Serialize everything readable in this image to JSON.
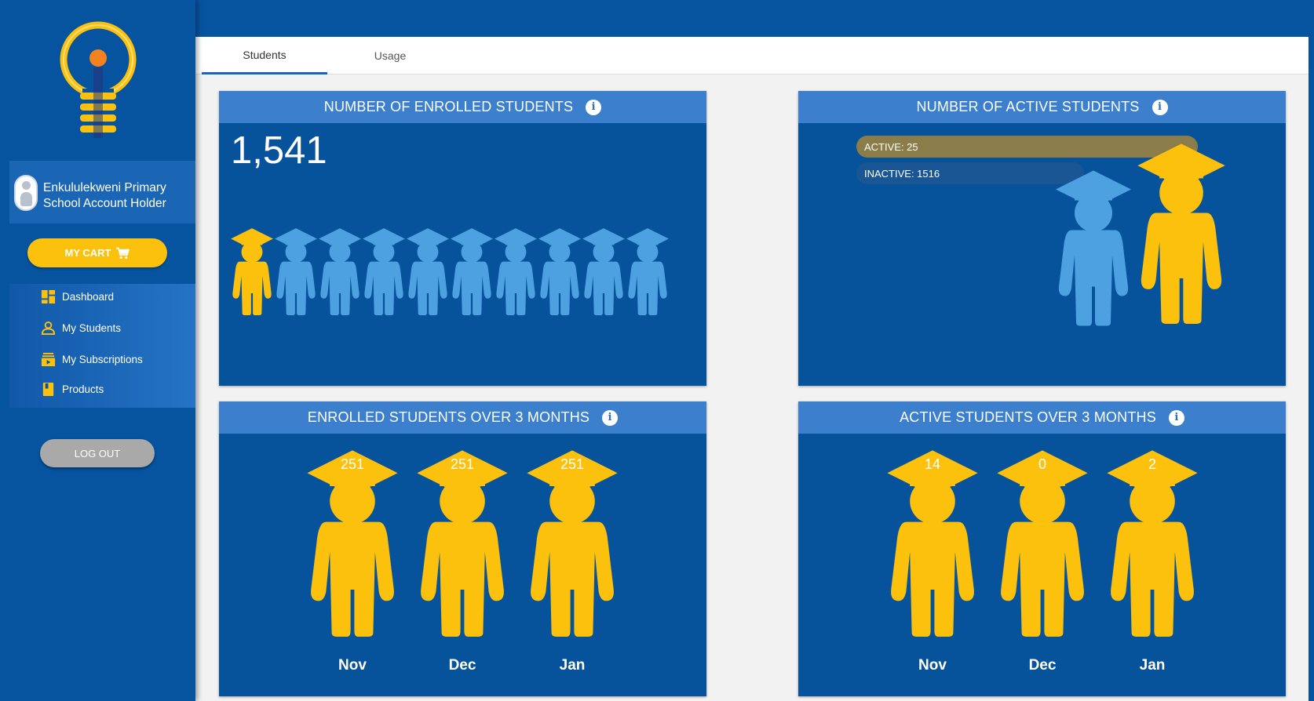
{
  "sidebar": {
    "account_name_line1": "Enkululekweni Primary",
    "account_name_line2": "School Account Holder",
    "cart_label": "MY CART",
    "nav": [
      {
        "label": "Dashboard",
        "icon": "dashboard-icon"
      },
      {
        "label": "My Students",
        "icon": "person-icon"
      },
      {
        "label": "My Subscriptions",
        "icon": "subscriptions-icon"
      },
      {
        "label": "Products",
        "icon": "book-icon"
      }
    ],
    "logout_label": "LOG OUT"
  },
  "tabs": [
    {
      "label": "Students",
      "active": true
    },
    {
      "label": "Usage",
      "active": false
    }
  ],
  "colors": {
    "brand_blue": "#0654a0",
    "header_blue": "#3b7fcd",
    "gold": "#fcc10c",
    "light_blue": "#4ea1e0"
  },
  "cards": {
    "enrolled": {
      "title": "NUMBER OF ENROLLED STUDENTS",
      "value": "1,541"
    },
    "active": {
      "title": "NUMBER OF ACTIVE STUDENTS",
      "active_label": "ACTIVE: 25",
      "inactive_label": "INACTIVE: 1516"
    },
    "enrolled_3m": {
      "title": "ENROLLED STUDENTS OVER 3 MONTHS",
      "values": [
        "251",
        "251",
        "251"
      ],
      "months": [
        "Nov",
        "Dec",
        "Jan"
      ]
    },
    "active_3m": {
      "title": "ACTIVE STUDENTS OVER 3 MONTHS",
      "values": [
        "14",
        "0",
        "2"
      ],
      "months": [
        "Nov",
        "Dec",
        "Jan"
      ]
    }
  }
}
